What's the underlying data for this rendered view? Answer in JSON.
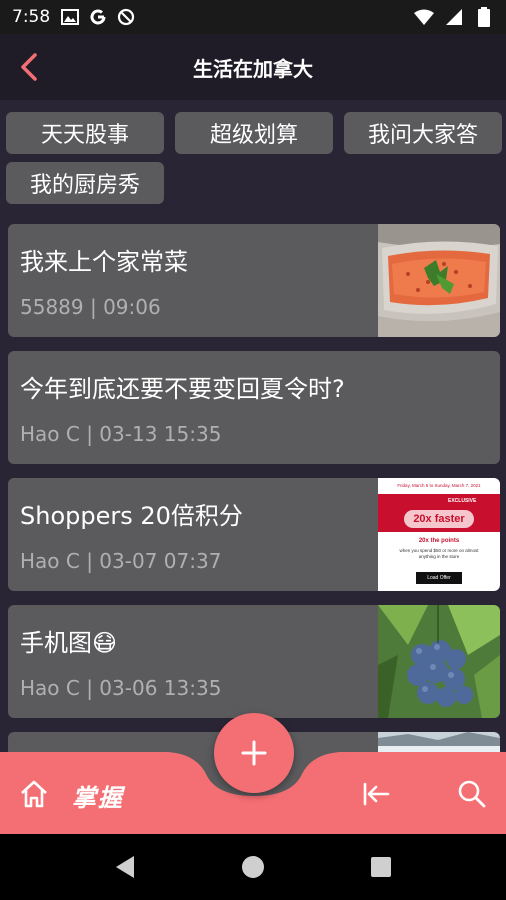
{
  "status_bar": {
    "time": "7:58",
    "left_icons": [
      "gallery-icon",
      "google-icon",
      "do-not-disturb-icon"
    ],
    "right_icons": [
      "wifi-icon",
      "cell-signal-icon",
      "battery-icon"
    ]
  },
  "app_bar": {
    "title": "生活在加拿大",
    "back_icon": "back-chevron-icon"
  },
  "chips": [
    "天天股事",
    "超级划算",
    "我问大家答",
    "我的厨房秀"
  ],
  "posts": [
    {
      "title": "我来上个家常菜",
      "meta": "55889 | 09:06",
      "thumb": "salmon-dish"
    },
    {
      "title": "今年到底还要不要变回夏令时?",
      "meta": "Hao C | 03-13 15:35",
      "thumb": ""
    },
    {
      "title": "Shoppers 20倍积分",
      "meta": "Hao C | 03-07 07:37",
      "thumb": "shoppers-ad",
      "thumb_text": {
        "top": "Friday, March 5 to Sunday, March 7, 2021",
        "brand": "EXCLUSIVE",
        "headline": "20x faster",
        "sub": "20x the points",
        "desc": "when you spend $50 or more on almost anything in the store",
        "button": "Load Offer"
      }
    },
    {
      "title": "手机图😷",
      "meta": "Hao C | 03-06 13:35",
      "thumb": "blueberries"
    },
    {
      "title": "",
      "meta": "",
      "thumb": "snowy-landscape"
    }
  ],
  "bottom_nav": {
    "label": "掌握",
    "home_icon": "home-icon",
    "collapse_icon": "collapse-left-icon",
    "search_icon": "search-icon",
    "fab_icon": "plus-icon"
  },
  "colors": {
    "accent": "#f46f73",
    "card": "#5b5b5e",
    "background": "#2a2535",
    "appbar": "#1f1c28"
  }
}
